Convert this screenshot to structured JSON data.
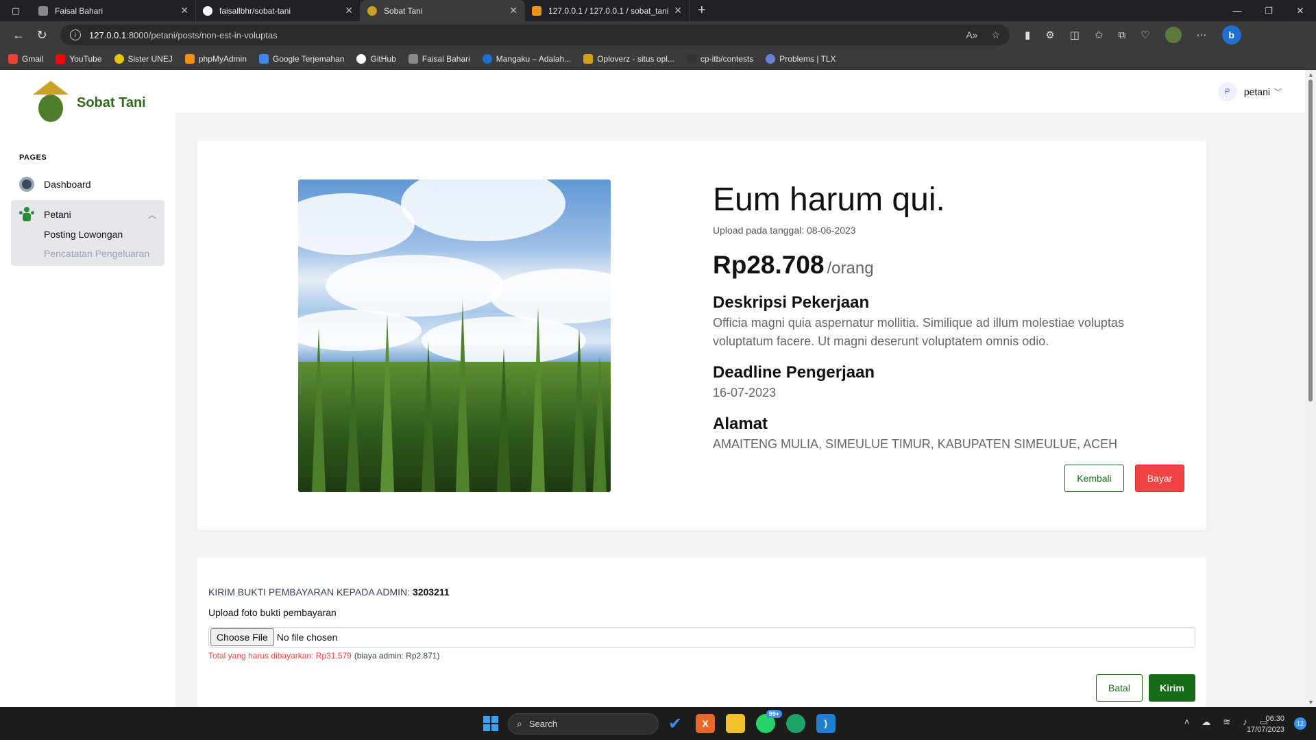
{
  "browser": {
    "tabs": [
      {
        "title": "Faisal Bahari",
        "color": "#8a8a8a"
      },
      {
        "title": "faisallbhr/sobat-tani",
        "color": "#ffffff"
      },
      {
        "title": "Sobat Tani",
        "color": "#c9a227"
      },
      {
        "title": "127.0.0.1 / 127.0.0.1 / sobat_tani",
        "color": "#f29111"
      }
    ],
    "url_host": "127.0.0.1",
    "url_path": ":8000/petani/posts/non-est-in-voluptas",
    "bookmarks": [
      {
        "label": "Gmail",
        "color": "#ea4335"
      },
      {
        "label": "YouTube",
        "color": "#ff0000"
      },
      {
        "label": "Sister UNEJ",
        "color": "#e6c300"
      },
      {
        "label": "phpMyAdmin",
        "color": "#f29111"
      },
      {
        "label": "Google Terjemahan",
        "color": "#4285f4"
      },
      {
        "label": "GitHub",
        "color": "#ffffff"
      },
      {
        "label": "Faisal Bahari",
        "color": "#8a8a8a"
      },
      {
        "label": "Mangaku – Adalah...",
        "color": "#1f6fd1"
      },
      {
        "label": "Oploverz - situs opl...",
        "color": "#d4a017"
      },
      {
        "label": "cp-itb/contests",
        "color": "#333333"
      },
      {
        "label": "Problems | TLX",
        "color": "#6b7fd7"
      }
    ]
  },
  "app": {
    "name": "Sobat Tani",
    "sidebar": {
      "section_label": "PAGES",
      "dashboard": "Dashboard",
      "group_label": "Petani",
      "sub_items": [
        "Posting Lowongan",
        "Pencatatan Pengeluaran"
      ]
    },
    "user": {
      "initial": "P",
      "name": "petani"
    }
  },
  "post": {
    "title": "Eum harum qui.",
    "upload_date": "Upload pada tanggal: 08-06-2023",
    "price": "Rp28.708",
    "price_unit": "/orang",
    "desc_heading": "Deskripsi Pekerjaan",
    "description": "Officia magni quia aspernatur mollitia. Similique ad illum molestiae voluptas voluptatum facere. Ut magni deserunt voluptatem omnis odio.",
    "deadline_heading": "Deadline Pengerjaan",
    "deadline": "16-07-2023",
    "address_heading": "Alamat",
    "address": "AMAITENG MULIA, SIMEULUE TIMUR, KABUPATEN SIMEULUE, ACEH",
    "back_button": "Kembali",
    "pay_button": "Bayar"
  },
  "payment": {
    "instruction": "KIRIM BUKTI PEMBAYARAN KEPADA ADMIN:",
    "admin_account": "3203211",
    "upload_label": "Upload foto bukti pembayaran",
    "choose_file": "Choose File",
    "no_file": "No file chosen",
    "total_text": "Total yang harus dibayarkan: Rp31.579",
    "admin_fee_text": "(biaya admin: Rp2.871)",
    "cancel_button": "Batal",
    "send_button": "Kirim"
  },
  "taskbar": {
    "search_placeholder": "Search",
    "whatsapp_badge": "99+",
    "time": "06:30",
    "date": "17/07/2023",
    "notifications": "12"
  }
}
